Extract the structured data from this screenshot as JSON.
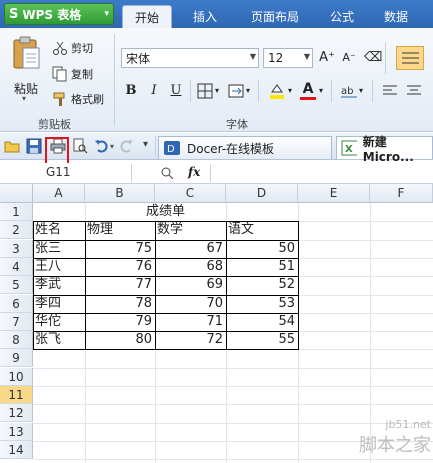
{
  "menu": {
    "app_button": "WPS 表格",
    "tabs": [
      "开始",
      "插入",
      "页面布局",
      "公式",
      "数据"
    ],
    "active_tab": "开始"
  },
  "ribbon": {
    "clipboard": {
      "paste": "粘贴",
      "cut": "剪切",
      "copy": "复制",
      "format_painter": "格式刷",
      "group_label": "剪贴板"
    },
    "font": {
      "font_name": "宋体",
      "font_size": "12",
      "grow_label": "A⁺",
      "shrink_label": "A⁻",
      "bold": "B",
      "italic": "I",
      "underline": "U",
      "font_color_label": "A",
      "group_label": "字体"
    }
  },
  "quick_access": {
    "doc_tabs": [
      {
        "label": "Docer-在线模板"
      },
      {
        "label": "新建 Micro..."
      }
    ]
  },
  "formula_bar": {
    "name_box": "G11",
    "fx": "fx"
  },
  "sheet": {
    "columns": [
      "A",
      "B",
      "C",
      "D",
      "E",
      "F"
    ],
    "rows": [
      "1",
      "2",
      "3",
      "4",
      "5",
      "6",
      "7",
      "8",
      "9",
      "10",
      "11",
      "12",
      "13",
      "14"
    ],
    "selected_row": "11",
    "title": "成绩单",
    "headers": [
      "姓名",
      "物理",
      "数学",
      "语文"
    ],
    "records": [
      {
        "name": "张三",
        "physics": "75",
        "math": "67",
        "chinese": "50"
      },
      {
        "name": "王八",
        "physics": "76",
        "math": "68",
        "chinese": "51"
      },
      {
        "name": "李武",
        "physics": "77",
        "math": "69",
        "chinese": "52"
      },
      {
        "name": "李四",
        "physics": "78",
        "math": "70",
        "chinese": "53"
      },
      {
        "name": "华佗",
        "physics": "79",
        "math": "71",
        "chinese": "54"
      },
      {
        "name": "张飞",
        "physics": "80",
        "math": "72",
        "chinese": "55"
      }
    ]
  },
  "watermark": {
    "url": "jb51.net",
    "name": "脚本之家"
  },
  "colors": {
    "menubar": "#2f67b3",
    "highlight_box": "#e0141b",
    "selected_row": "#f8d98a"
  }
}
